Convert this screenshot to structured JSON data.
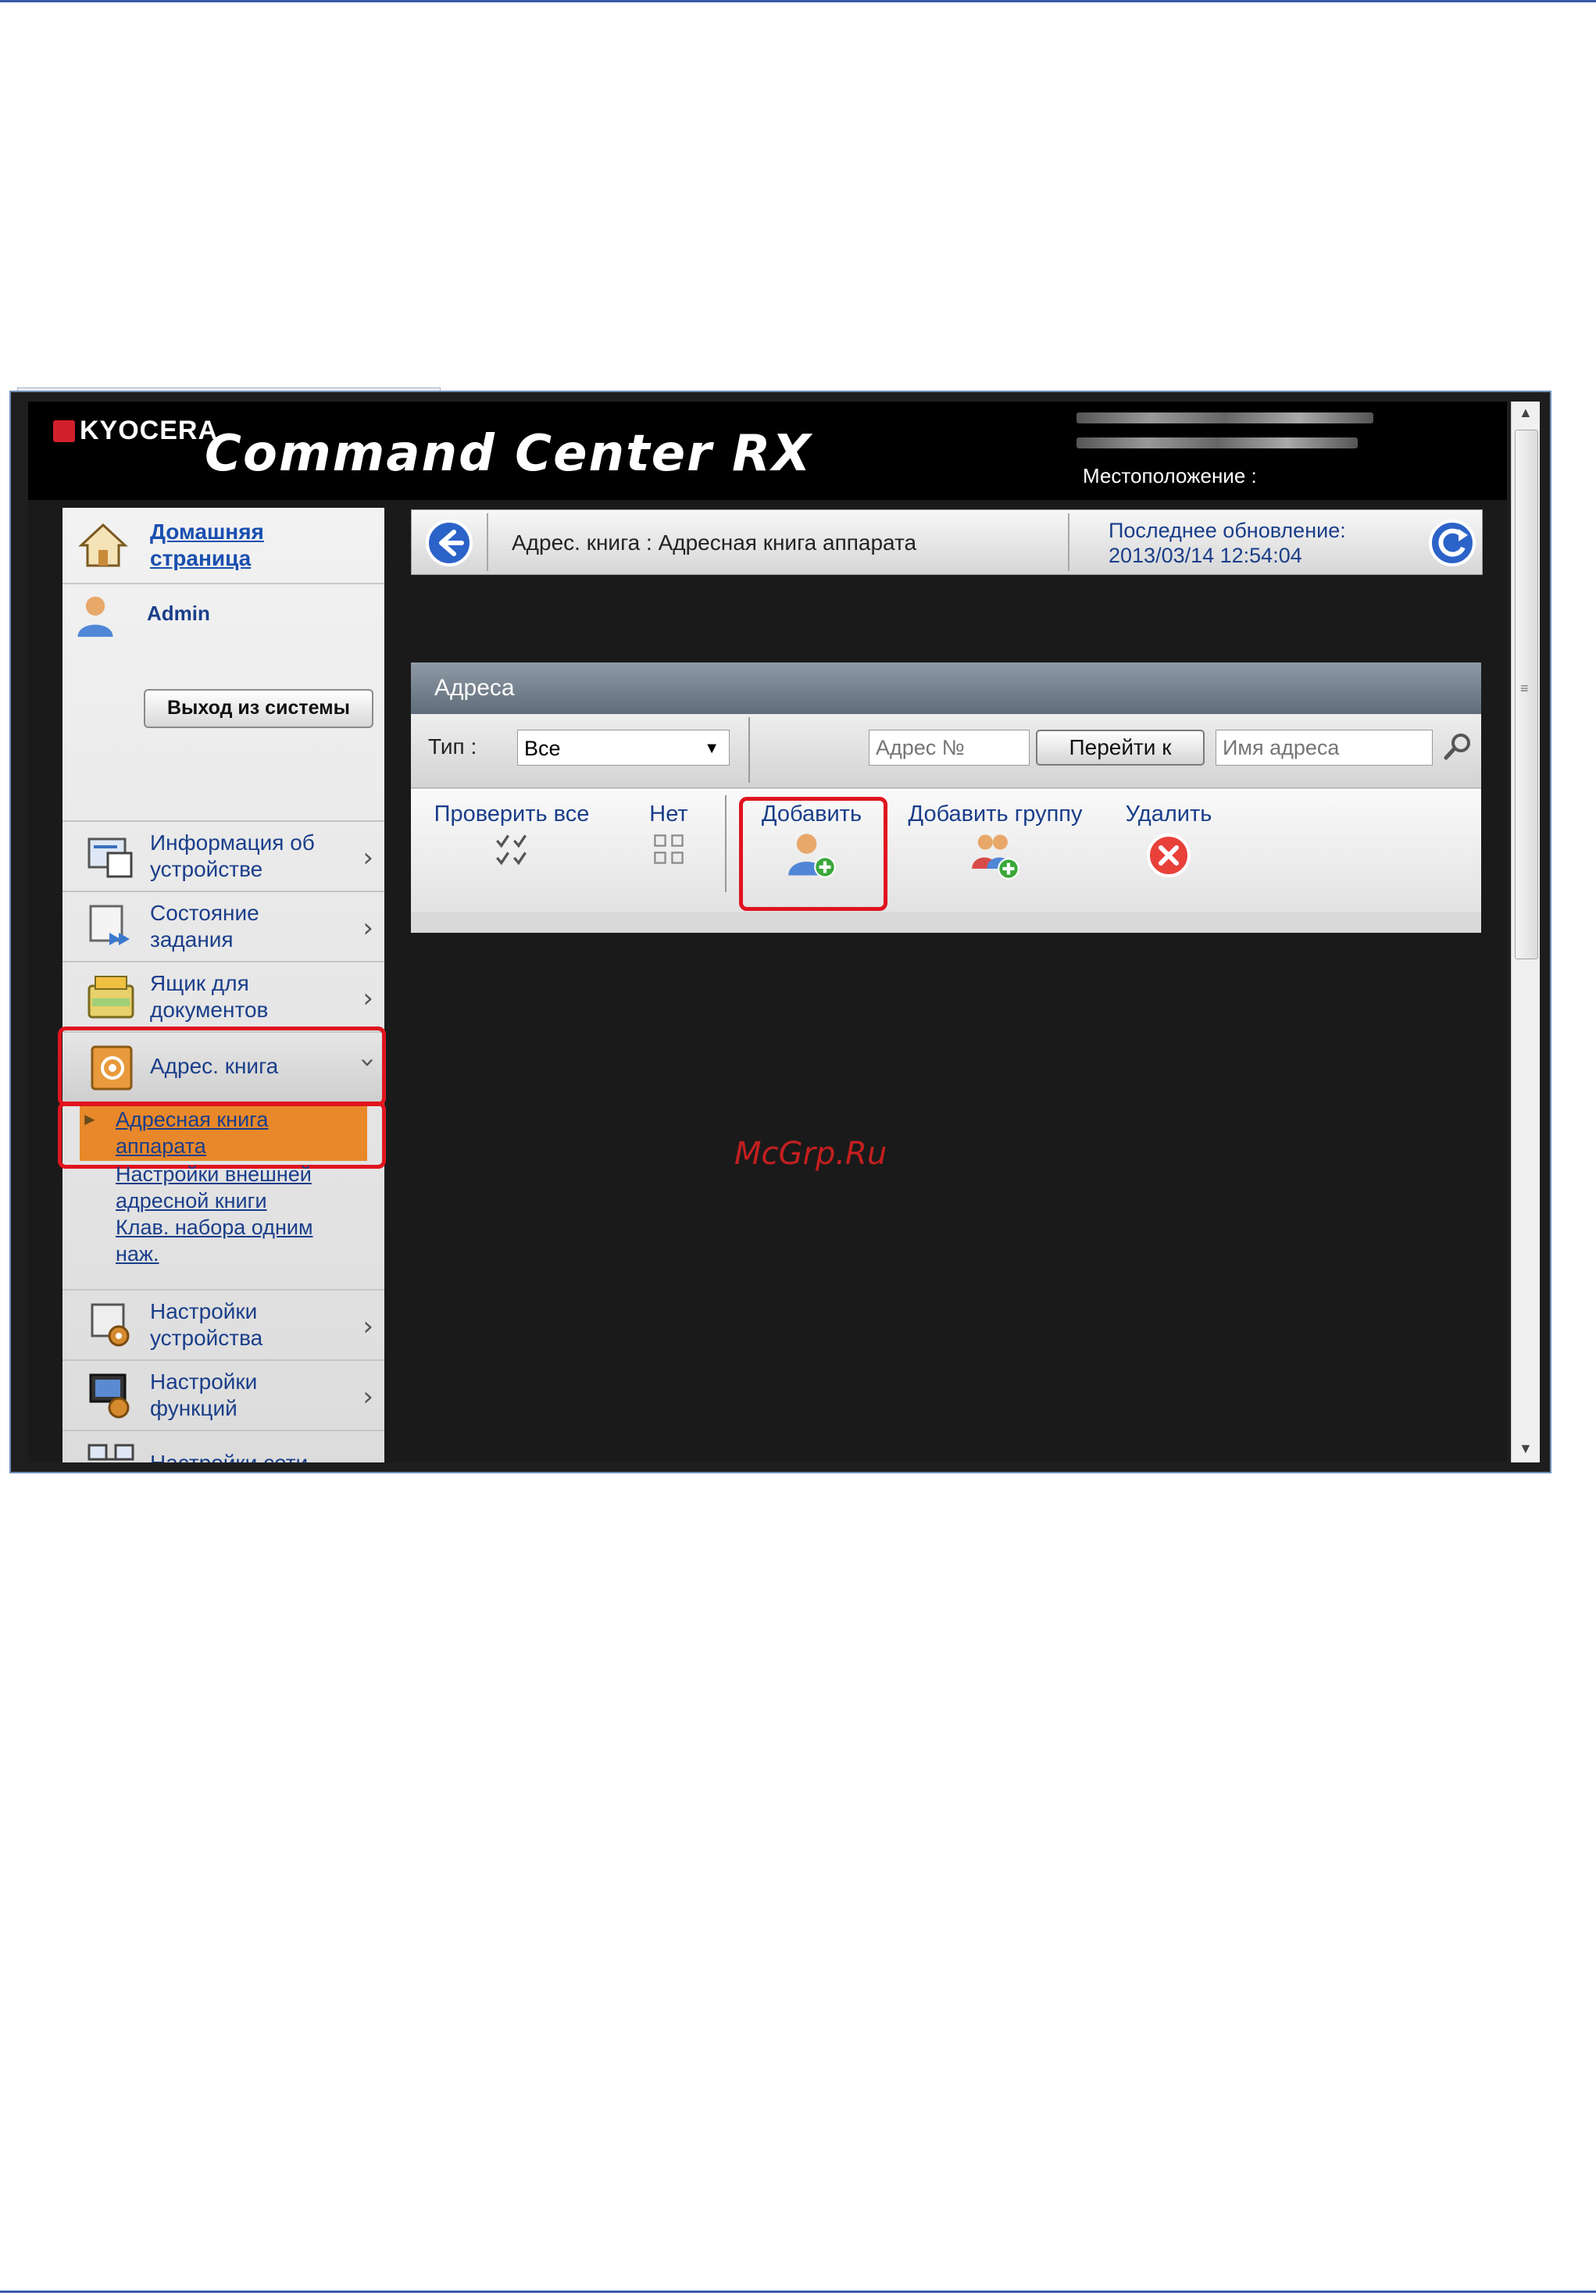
{
  "header": {
    "brand_logo": "KYOCERA",
    "product": "Command Center RX",
    "location_label": "Местоположение :"
  },
  "sidebar": {
    "home_label": "Домашняя страница",
    "user_name": "Admin",
    "logout_label": "Выход из системы",
    "items": [
      {
        "label": "Информация об устройстве",
        "icon": "device-info-icon"
      },
      {
        "label": "Состояние задания",
        "icon": "job-status-icon"
      },
      {
        "label": "Ящик для документов",
        "icon": "document-box-icon"
      },
      {
        "label": "Адрес. книга",
        "icon": "address-book-icon",
        "expanded": true
      },
      {
        "label": "Настройки устройства",
        "icon": "device-settings-icon"
      },
      {
        "label": "Настройки функций",
        "icon": "function-settings-icon"
      },
      {
        "label": "Настройки сети",
        "icon": "network-settings-icon"
      }
    ],
    "submenu": [
      "Адресная книга аппарата",
      "Настройки внешней адресной книги",
      "Клав. набора одним наж."
    ]
  },
  "breadcrumb": {
    "path": "Адрес. книга : Адресная книга аппарата",
    "last_update_label": "Последнее обновление:",
    "last_update_value": "2013/03/14 12:54:04"
  },
  "addresses": {
    "title": "Адреса",
    "type_label": "Тип :",
    "type_value": "Все",
    "address_no_placeholder": "Адрес №",
    "goto_label": "Перейти к",
    "address_name_placeholder": "Имя адреса",
    "actions": {
      "check_all": "Проверить все",
      "none": "Нет",
      "add": "Добавить",
      "add_group": "Добавить группу",
      "delete": "Удалить"
    }
  },
  "watermark": "McGrp.Ru",
  "colors": {
    "highlight": "#e0141e",
    "selected": "#e8882a",
    "link": "#1a3e8a"
  }
}
